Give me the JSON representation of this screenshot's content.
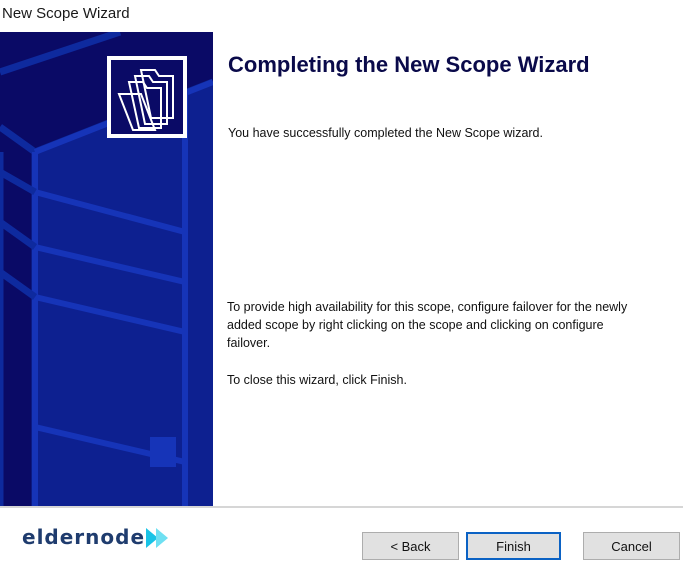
{
  "window": {
    "title": "New Scope Wizard"
  },
  "main": {
    "heading": "Completing the New Scope Wizard",
    "success_message": "You have successfully completed the New Scope wizard.",
    "failover_message": "To provide high availability for this scope, configure failover for the newly added scope by right clicking on the scope and clicking on configure failover.",
    "close_message": "To close this wizard, click Finish."
  },
  "buttons": {
    "back": "< Back",
    "finish": "Finish",
    "cancel": "Cancel"
  },
  "watermark": {
    "brand": "eldernode"
  },
  "colors": {
    "side_panel": "#0a0a66",
    "heading": "#0a0a4a",
    "button_face": "#e1e1e1",
    "default_button_border": "#0b62c4",
    "brand": "#1f3c6e",
    "brand_accent": "#19c3e6"
  },
  "icons": {
    "wizard_logo": "folders-icon",
    "side_graphic": "server-illustration"
  }
}
